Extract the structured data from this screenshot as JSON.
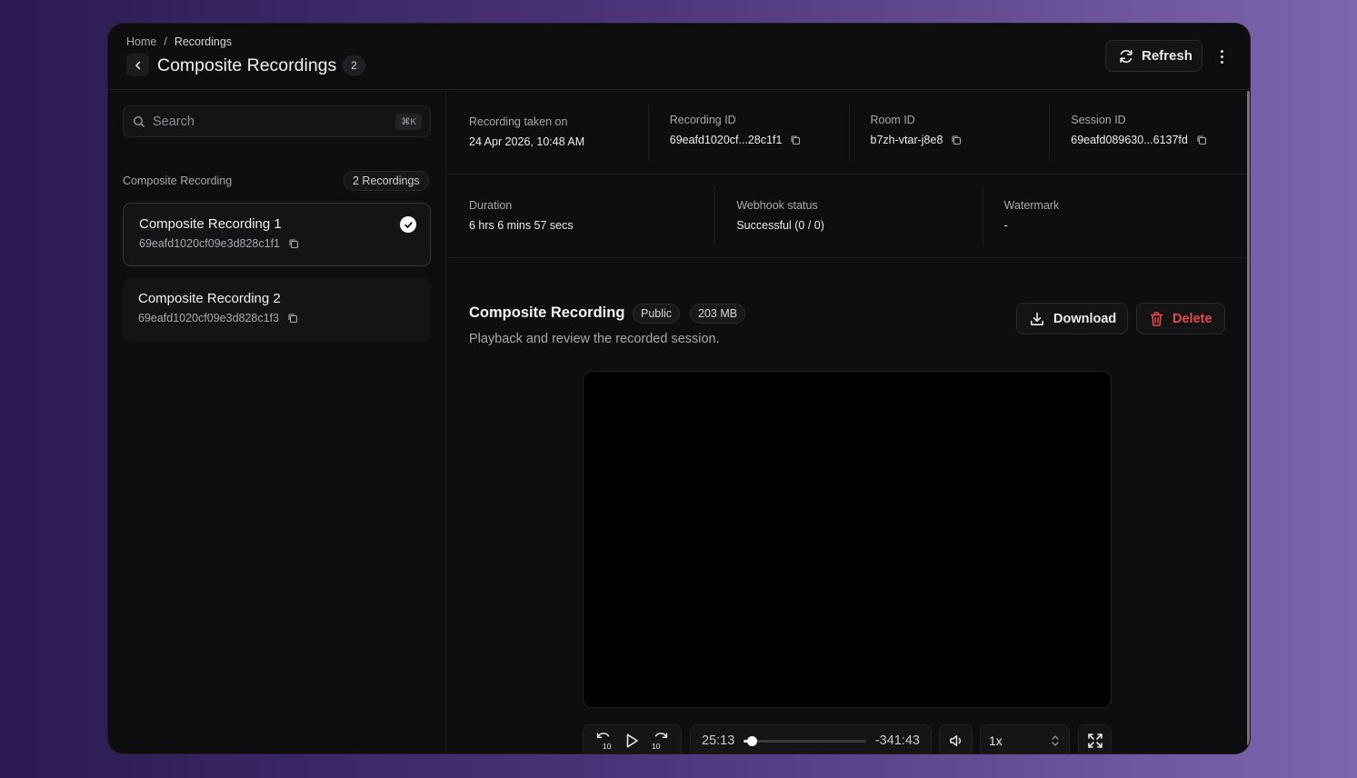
{
  "breadcrumb": {
    "home": "Home",
    "separator": "/",
    "current": "Recordings"
  },
  "header": {
    "title": "Composite Recordings",
    "count": "2",
    "refresh_label": "Refresh"
  },
  "sidebar": {
    "search_placeholder": "Search",
    "search_shortcut": "⌘K",
    "list_label": "Composite Recording",
    "list_count": "2 Recordings",
    "items": [
      {
        "title": "Composite Recording 1",
        "id": "69eafd1020cf09e3d828c1f1",
        "selected": true
      },
      {
        "title": "Composite Recording 2",
        "id": "69eafd1020cf09e3d828c1f3",
        "selected": false
      }
    ]
  },
  "meta": {
    "row1": [
      {
        "label": "Recording taken on",
        "value": "24 Apr 2026, 10:48 AM",
        "copy": false
      },
      {
        "label": "Recording ID",
        "value": "69eafd1020cf...28c1f1",
        "copy": true
      },
      {
        "label": "Room ID",
        "value": "b7zh-vtar-j8e8",
        "copy": true
      },
      {
        "label": "Session ID",
        "value": "69eafd089630...6137fd",
        "copy": true
      }
    ],
    "row2": [
      {
        "label": "Duration",
        "value": "6 hrs 6 mins 57 secs"
      },
      {
        "label": "Webhook status",
        "value": "Successful (0 / 0)"
      },
      {
        "label": "Watermark",
        "value": "-"
      }
    ]
  },
  "recording": {
    "title": "Composite Recording",
    "visibility": "Public",
    "size": "203 MB",
    "subtitle": "Playback and review the recorded session.",
    "download_label": "Download",
    "delete_label": "Delete"
  },
  "player": {
    "elapsed": "25:13",
    "remaining": "-341:43",
    "progress_fraction": 0.068,
    "speed": "1x",
    "skip_back_label": "10",
    "skip_forward_label": "10"
  },
  "colors": {
    "background": "#0e0e10",
    "danger": "#e5484d",
    "text": "#ececef",
    "muted": "#a8a8ad"
  }
}
